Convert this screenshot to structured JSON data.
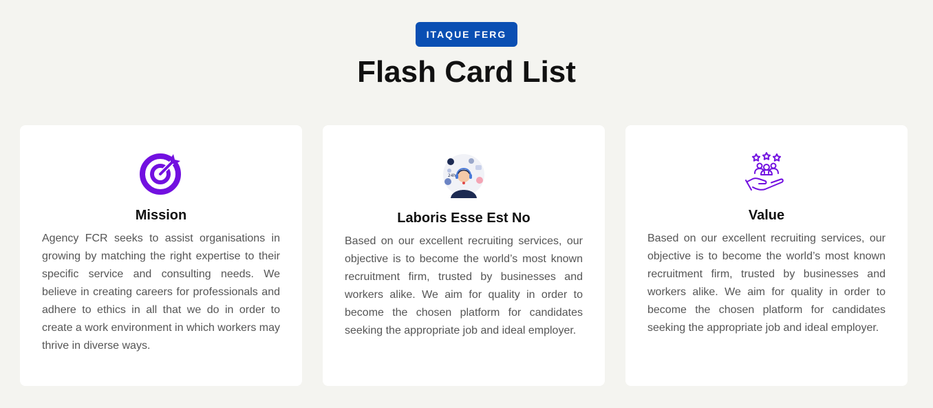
{
  "header": {
    "badge": "ITAQUE FERG",
    "title": "Flash Card List"
  },
  "cards": [
    {
      "icon": "target-icon",
      "title": "Mission",
      "text": "Agency FCR seeks to assist organisations in growing by matching the right expertise to their specific service and consulting needs. We believe in creating careers for professionals and adhere to ethics in all that we do in order to create a work environment in which workers may thrive in diverse ways."
    },
    {
      "icon": "support-agent-icon",
      "title": "Laboris Esse Est No",
      "text": "Based on our excellent recruiting services, our objective is to become the world’s most known recruitment firm, trusted by businesses and workers alike. We aim for quality in order to become the chosen platform for candidates seeking the appropriate job and ideal employer."
    },
    {
      "icon": "hand-people-stars-icon",
      "title": "Value",
      "text": "Based on our excellent recruiting services, our objective is to become the world’s most known recruitment firm, trusted by businesses and workers alike. We aim for quality in order to become the chosen platform for candidates seeking the appropriate job and ideal employer."
    }
  ],
  "colors": {
    "background": "#f4f4f0",
    "badge": "#0a4fb3",
    "icon_purple": "#7210e0"
  }
}
